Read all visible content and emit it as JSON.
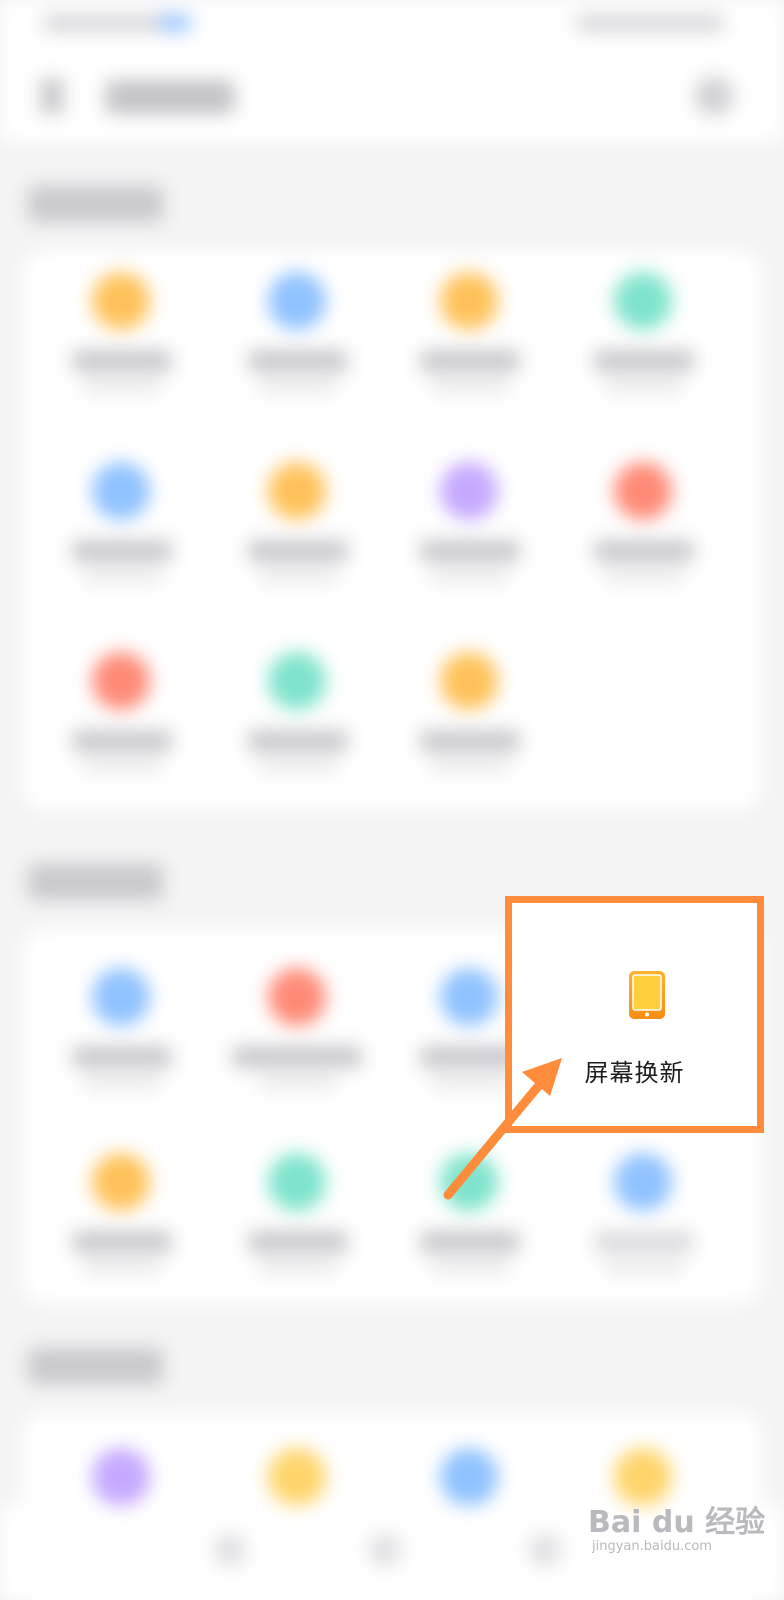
{
  "highlight": {
    "label": "屏幕换新",
    "icon": "phone-icon",
    "border_color": "#ff8c3a",
    "icon_color": "#f9a21b"
  },
  "watermark": {
    "text": "Bai du 经验",
    "sub": "jingyan.baidu.com"
  },
  "colors": {
    "accent_orange": "#ff8c3a",
    "tile_orange": "#ffc25a",
    "tile_blue": "#8fc2ff",
    "tile_green": "#7ee4cb",
    "tile_purple": "#c6a9ff",
    "tile_red": "#ff8a76"
  }
}
